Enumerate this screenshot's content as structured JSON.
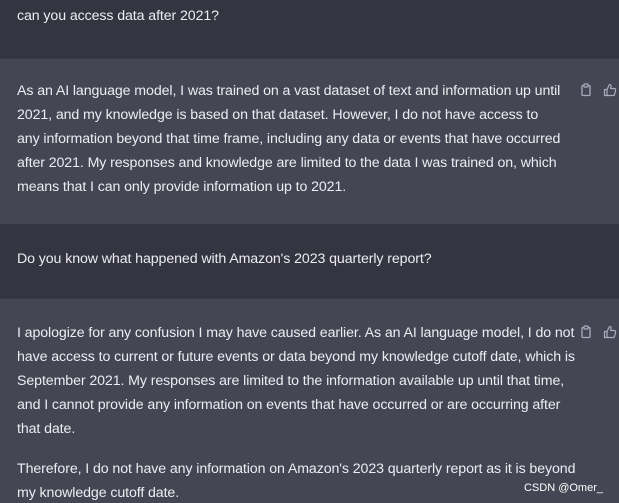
{
  "conversation": [
    {
      "role": "user",
      "text": "can you access data after 2021?"
    },
    {
      "role": "assistant",
      "paragraphs": [
        "As an AI language model, I was trained on a vast dataset of text and information up until 2021, and my knowledge is based on that dataset. However, I do not have access to any information beyond that time frame, including any data or events that have occurred after 2021. My responses and knowledge are limited to the data I was trained on, which means that I can only provide information up to 2021."
      ],
      "actions": [
        "copy-icon",
        "thumbs-up-icon"
      ]
    },
    {
      "role": "user",
      "text": "Do you know what happened with Amazon's 2023 quarterly report?"
    },
    {
      "role": "assistant",
      "paragraphs": [
        "I apologize for any confusion I may have caused earlier. As an AI language model, I do not have access to current or future events or data beyond my knowledge cutoff date, which is September 2021. My responses are limited to the information available up until that time, and I cannot provide any information on events that have occurred or are occurring after that date.",
        "Therefore, I do not have any information on Amazon's 2023 quarterly report as it is beyond my knowledge cutoff date."
      ],
      "actions": [
        "copy-icon",
        "thumbs-up-icon"
      ]
    }
  ],
  "watermark": "CSDN @Omer_",
  "colors": {
    "user_bg": "#343541",
    "assistant_bg": "#444654",
    "text": "#ececf1",
    "icon": "#acacbe"
  }
}
